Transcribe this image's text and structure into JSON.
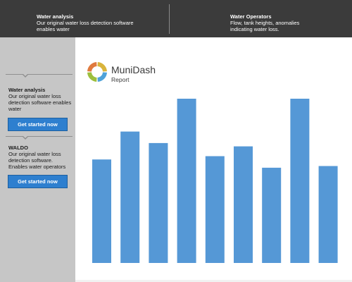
{
  "header": {
    "left": {
      "title": "Water analysis",
      "subtitle": "Our original water loss detection software enables water"
    },
    "right": {
      "title": "Water Operators",
      "subtitle": "Flow, tank heights, anomalies indicating water loss."
    }
  },
  "sidebar": {
    "sections": [
      {
        "title": "Water analysis",
        "subtitle": "Our original water loss detection software enables water",
        "button_label": "Get started now"
      },
      {
        "title": "WALDO",
        "subtitle": "Our original water loss detection software. Enables water operators",
        "button_label": "Get started now"
      }
    ]
  },
  "main": {
    "brand": "MuniDash",
    "brand_sub": "Report",
    "logo_colors": [
      "#d9b43c",
      "#4fa2d9",
      "#9dbf3d",
      "#e07a3e"
    ]
  },
  "colors": {
    "header_bg": "#3b3b3b",
    "sidebar_bg": "#c6c6c6",
    "button_bg": "#2e7fcf",
    "bar": "#5598d6"
  },
  "chart_data": {
    "type": "bar",
    "categories": [
      "",
      "",
      "",
      "",
      "",
      "",
      "",
      "",
      ""
    ],
    "values": [
      63,
      80,
      73,
      100,
      65,
      71,
      58,
      100,
      59
    ],
    "title": "",
    "xlabel": "",
    "ylabel": "",
    "ylim": [
      0,
      100
    ],
    "grid": false
  }
}
